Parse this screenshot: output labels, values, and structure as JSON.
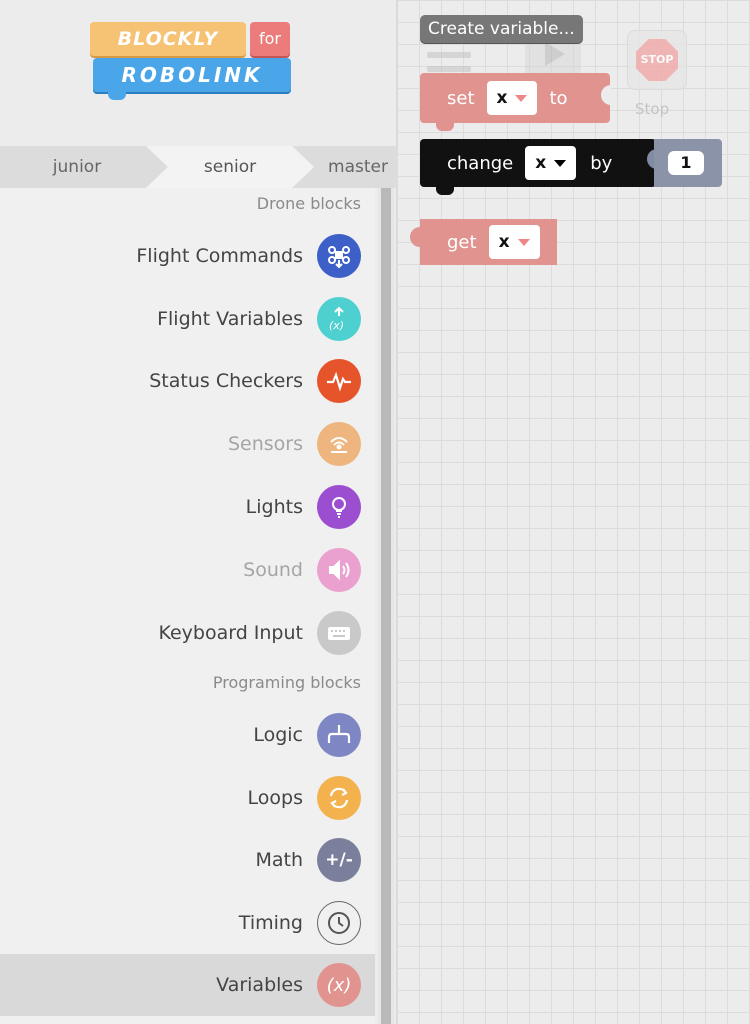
{
  "logo": {
    "line1": "BLOCKLY",
    "for": "for",
    "line2": "ROBOLINK"
  },
  "level_tabs": [
    "junior",
    "senior",
    "master"
  ],
  "selected_level": "senior",
  "sections": {
    "drone": "Drone blocks",
    "programming": "Programing blocks"
  },
  "categories": [
    {
      "label": "Flight Commands",
      "icon": "drone-icon",
      "color": "#3d5fc8"
    },
    {
      "label": "Flight Variables",
      "icon": "variable-up-icon",
      "color": "#4ecfd0"
    },
    {
      "label": "Status Checkers",
      "icon": "pulse-icon",
      "color": "#e5542a"
    },
    {
      "label": "Sensors",
      "icon": "sensor-icon",
      "color": "#efb57e",
      "dim": true
    },
    {
      "label": "Lights",
      "icon": "lightbulb-icon",
      "color": "#9b4fd0"
    },
    {
      "label": "Sound",
      "icon": "speaker-icon",
      "color": "#eaa1cf",
      "dim": true
    },
    {
      "label": "Keyboard Input",
      "icon": "keyboard-icon",
      "color": "#c9c9c9"
    },
    {
      "label": "Logic",
      "icon": "logic-icon",
      "color": "#7e86c4"
    },
    {
      "label": "Loops",
      "icon": "loop-icon",
      "color": "#f3b24d"
    },
    {
      "label": "Math",
      "icon": "plus-minus-icon",
      "color": "#7a7f9c"
    },
    {
      "label": "Timing",
      "icon": "clock-icon",
      "color": "#f0f0f0"
    },
    {
      "label": "Variables",
      "icon": "variable-icon",
      "color": "#e0938f",
      "selected": true
    }
  ],
  "workspace": {
    "create_variable": "Create variable...",
    "stop_icon_text": "STOP",
    "stop_label": "Stop",
    "set_block": {
      "kw1": "set",
      "var": "x",
      "kw2": "to"
    },
    "change_block": {
      "kw1": "change",
      "var": "x",
      "kw2": "by",
      "value": "1"
    },
    "get_block": {
      "kw1": "get",
      "var": "x"
    }
  }
}
